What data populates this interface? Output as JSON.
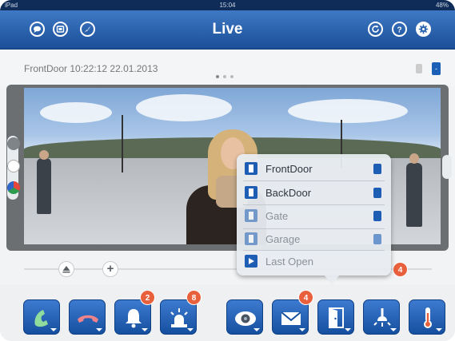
{
  "status_bar": {
    "device": "iPad",
    "time": "15:04",
    "battery": "48%"
  },
  "navbar": {
    "title": "Live",
    "left_icons": [
      "chat-bubble-icon",
      "screens-icon",
      "compass-icon"
    ],
    "right_icons": [
      "refresh-icon",
      "help-icon",
      "settings-gear-icon"
    ]
  },
  "camera": {
    "name_time": "FrontDoor 10:22:12 22.01.2013",
    "page_count": 3,
    "active_page": 1,
    "zoom_button_label": "-"
  },
  "popup": {
    "items": [
      {
        "label": "FrontDoor",
        "icon": "door-icon",
        "action_icon": "lock-icon",
        "dim": false
      },
      {
        "label": "BackDoor",
        "icon": "door-icon",
        "action_icon": "minus-icon",
        "dim": false
      },
      {
        "label": "Gate",
        "icon": "door-icon",
        "action_icon": "door-open-icon",
        "dim": true
      },
      {
        "label": "Garage",
        "icon": "door-icon",
        "action_icon": "minus-icon",
        "dim": true
      }
    ],
    "last_open_label": "Last Open"
  },
  "slider": {
    "badge": "4"
  },
  "toolbar": {
    "buttons": [
      {
        "name": "call-accept",
        "icon": "phone-accept-icon"
      },
      {
        "name": "call-end",
        "icon": "phone-end-icon"
      },
      {
        "name": "bell",
        "icon": "bell-icon",
        "badge": "2"
      },
      {
        "name": "alarm",
        "icon": "alarm-light-icon",
        "badge": "8"
      },
      {
        "name": "hemispheric-camera",
        "icon": "camera-lens-icon"
      },
      {
        "name": "messages",
        "icon": "mail-icon",
        "badge": "4"
      },
      {
        "name": "door",
        "icon": "door-open-icon"
      },
      {
        "name": "light",
        "icon": "light-icon"
      },
      {
        "name": "temperature",
        "icon": "thermometer-icon"
      }
    ]
  },
  "colors": {
    "accent_blue": "#1c5fb6",
    "badge_orange": "#e8603c",
    "nav_blue": "#2d66b1"
  }
}
